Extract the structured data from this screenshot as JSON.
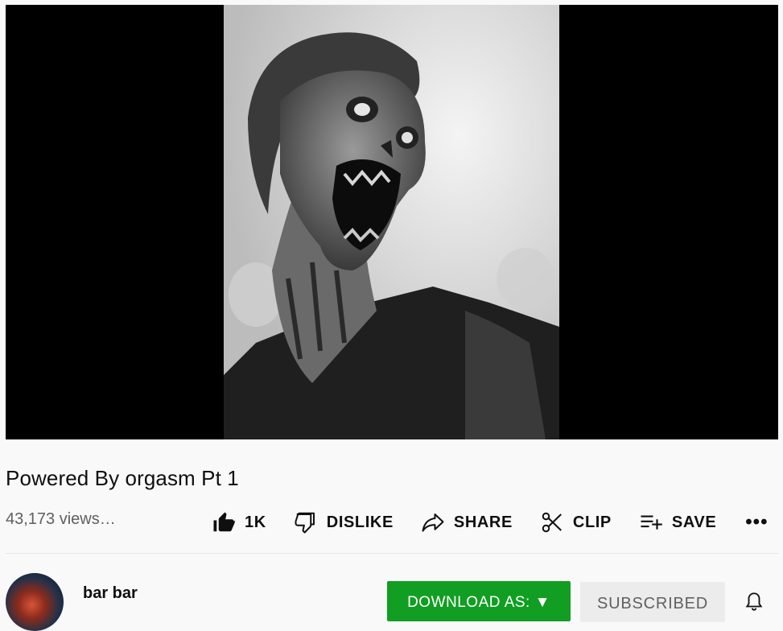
{
  "video": {
    "title": "Powered By orgasm Pt 1",
    "views": "43,173 views…",
    "thumbnail_icon": "zombie-artwork-image"
  },
  "actions": {
    "like_count": "1K",
    "dislike_label": "DISLIKE",
    "share_label": "SHARE",
    "clip_label": "CLIP",
    "save_label": "SAVE",
    "more_label": "•••"
  },
  "channel": {
    "name": "bar bar",
    "download_label": "DOWNLOAD AS: ▼",
    "subscribed_label": "SUBSCRIBED"
  },
  "colors": {
    "download_bg": "#119e22",
    "subscribed_bg": "#ececec",
    "page_bg": "#f9f9f9"
  }
}
